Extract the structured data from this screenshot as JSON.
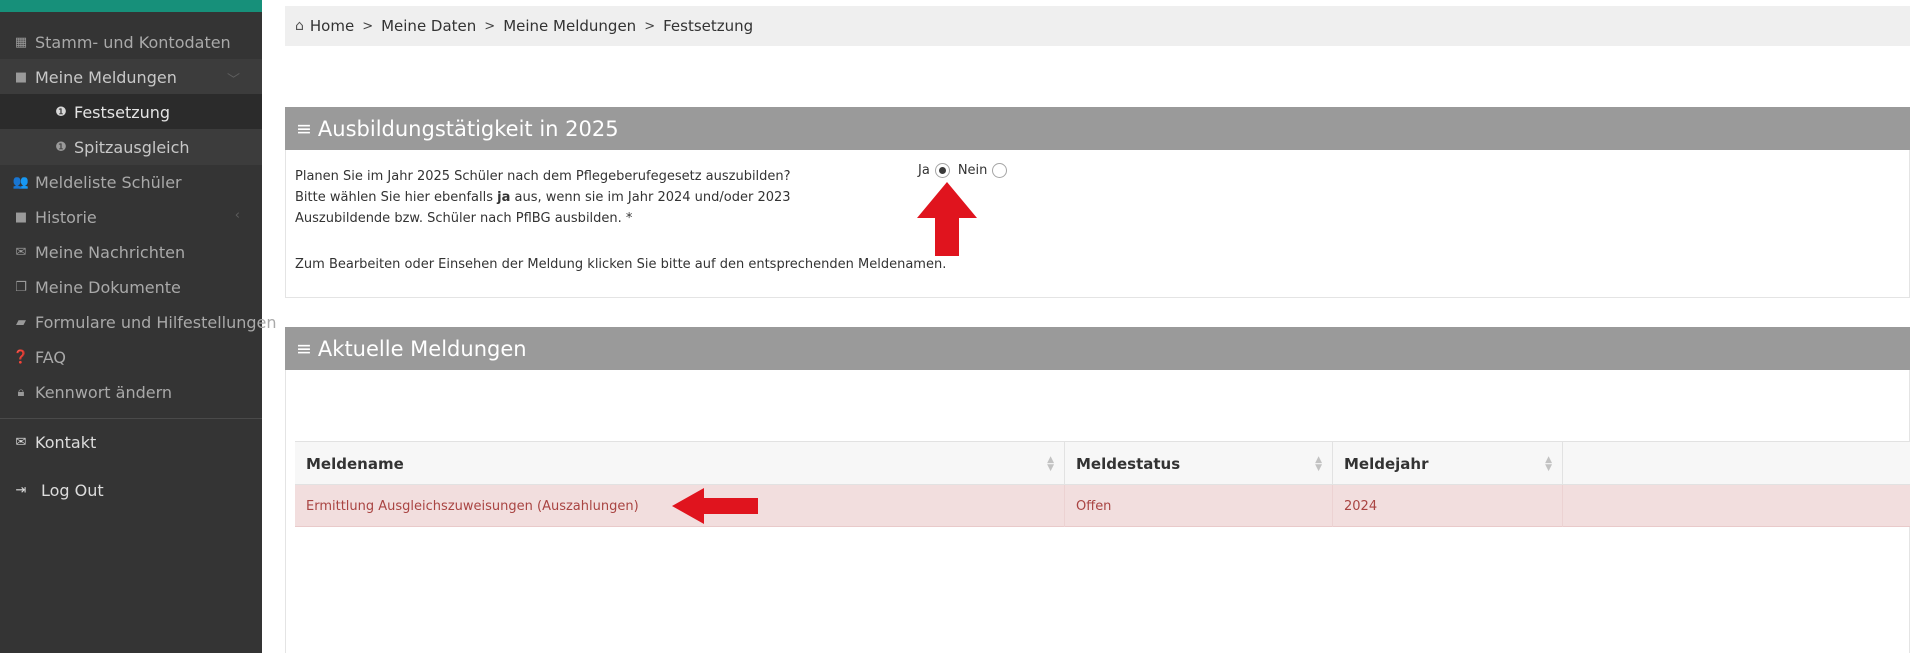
{
  "sidebar": {
    "items": [
      {
        "label": "Stamm- und Kontodaten",
        "icon": "calendar-icon"
      },
      {
        "label": "Meine Meldungen",
        "icon": "folder-icon"
      },
      {
        "label": "Festsetzung",
        "icon": "info-circle-icon"
      },
      {
        "label": "Spitzausgleich",
        "icon": "info-circle-icon"
      },
      {
        "label": "Meldeliste Schüler",
        "icon": "users-icon"
      },
      {
        "label": "Historie",
        "icon": "folder-icon"
      },
      {
        "label": "Meine Nachrichten",
        "icon": "envelope-icon"
      },
      {
        "label": "Meine Dokumente",
        "icon": "copy-icon"
      },
      {
        "label": "Formulare und Hilfestellungen",
        "icon": "book-icon"
      },
      {
        "label": "FAQ",
        "icon": "question-circle-icon"
      },
      {
        "label": "Kennwort ändern",
        "icon": "lock-icon"
      },
      {
        "label": "Kontakt",
        "icon": "envelope-outline-icon"
      },
      {
        "label": "Log Out",
        "icon": "sign-out-icon"
      }
    ]
  },
  "breadcrumb": {
    "items": [
      "Home",
      "Meine Daten",
      "Meine Meldungen",
      "Festsetzung"
    ]
  },
  "ausbildung": {
    "title": "Ausbildungstätigkeit in 2025",
    "question_line1": "Planen Sie im Jahr 2025 Schüler nach dem Pflegeberufegesetz auszubilden?",
    "question_line2_before": "Bitte wählen Sie hier ebenfalls ",
    "question_line2_bold": "ja",
    "question_line2_after": " aus, wenn sie im Jahr 2024 und/oder 2023",
    "question_line3": "Auszubildende bzw. Schüler nach PflBG ausbilden. *",
    "option_yes": "Ja",
    "option_no": "Nein",
    "selected": "Ja",
    "hint": "Zum Bearbeiten oder Einsehen der Meldung klicken Sie bitte auf den entsprechenden Meldenamen."
  },
  "meldungen": {
    "title": "Aktuelle Meldungen",
    "columns": [
      "Meldename",
      "Meldestatus",
      "Meldejahr"
    ],
    "rows": [
      {
        "name": "Ermittlung Ausgleichszuweisungen (Auszahlungen)",
        "status": "Offen",
        "year": "2024"
      }
    ]
  },
  "colors": {
    "sidebar_bg": "#343434",
    "accent": "#17907a",
    "panel_header": "#9a9a9a",
    "row_highlight": "#f2dede",
    "row_text": "#a94442",
    "annotation_arrow": "#e0141e"
  }
}
